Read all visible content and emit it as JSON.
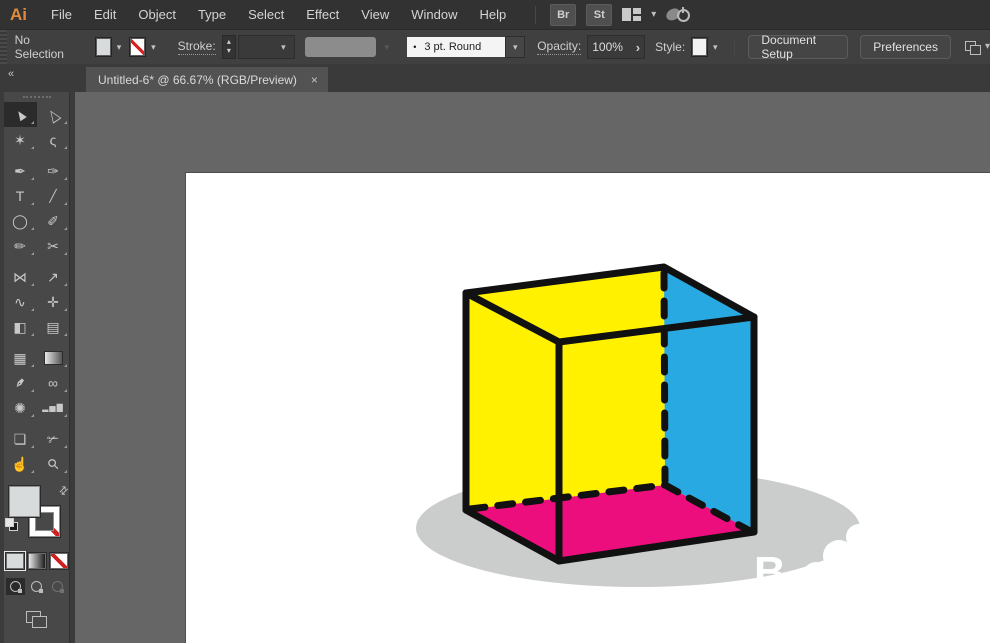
{
  "menu_bar": {
    "logo": "Ai",
    "items": [
      "File",
      "Edit",
      "Object",
      "Type",
      "Select",
      "Effect",
      "View",
      "Window",
      "Help"
    ],
    "badges": [
      "Br",
      "St"
    ]
  },
  "control_bar": {
    "selection_status": "No Selection",
    "stroke_label": "Stroke:",
    "brush_definition": "3 pt. Round",
    "opacity_label": "Opacity:",
    "opacity_value": "100%",
    "style_label": "Style:",
    "document_setup_label": "Document Setup",
    "preferences_label": "Preferences"
  },
  "tab": {
    "title": "Untitled-6* @ 66.67% (RGB/Preview)",
    "close": "×"
  },
  "icons": {
    "collapse": "«",
    "chevron_down": "▾",
    "stepper_up": "▴",
    "stepper_down": "▾",
    "bullet": "•",
    "opacity_arrow": "›",
    "swap_arrows": "⇄"
  },
  "tools": [
    {
      "name": "selection",
      "glyph": "▲",
      "selected": true
    },
    {
      "name": "direct-selection",
      "glyph": "△"
    },
    {
      "name": "magic-wand",
      "glyph": "✶"
    },
    {
      "name": "lasso",
      "glyph": "ς"
    },
    {
      "name": "pen",
      "glyph": "✒"
    },
    {
      "name": "curvature",
      "glyph": "✑"
    },
    {
      "name": "type",
      "glyph": "T"
    },
    {
      "name": "line-segment",
      "glyph": "╱"
    },
    {
      "name": "ellipse",
      "glyph": "◯"
    },
    {
      "name": "paintbrush",
      "glyph": "✐"
    },
    {
      "name": "pencil",
      "glyph": "✏"
    },
    {
      "name": "scissors",
      "glyph": "✂"
    },
    {
      "name": "reflect",
      "glyph": "⋈"
    },
    {
      "name": "scale",
      "glyph": "↗"
    },
    {
      "name": "width",
      "glyph": "∿"
    },
    {
      "name": "puppet-warp",
      "glyph": "✛"
    },
    {
      "name": "shape-builder",
      "glyph": "◧"
    },
    {
      "name": "perspective-grid",
      "glyph": "▤"
    },
    {
      "name": "mesh",
      "glyph": "▦"
    },
    {
      "name": "gradient",
      "glyph": ""
    },
    {
      "name": "eyedropper",
      "glyph": "✒"
    },
    {
      "name": "blend",
      "glyph": "∞"
    },
    {
      "name": "symbol-sprayer",
      "glyph": "✺"
    },
    {
      "name": "column-graph",
      "glyph": "▂▅▇"
    },
    {
      "name": "artboard",
      "glyph": "❏"
    },
    {
      "name": "slice",
      "glyph": "✃"
    },
    {
      "name": "hand",
      "glyph": "☝"
    },
    {
      "name": "zoom",
      "glyph": "⚲"
    }
  ],
  "colors": {
    "yellow": "#FFF100",
    "blue": "#29A9E1",
    "pink": "#ED0E7E",
    "shadow": "#CBCCCC",
    "line": "#111111",
    "white": "#FFFFFF"
  },
  "canvas": {
    "watermark_letter": "B"
  }
}
